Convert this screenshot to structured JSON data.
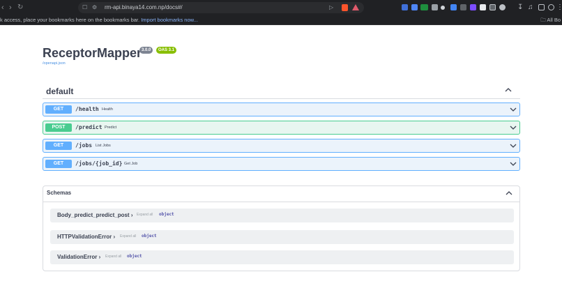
{
  "browser": {
    "url": "rm-api.binaya14.com.np/docs#/",
    "bookmarks_bar_text": "k access, place your bookmarks here on the bookmarks bar.",
    "import_link": "Import bookmarks now...",
    "all_bookmarks": "All Bo",
    "icons": [
      "back-icon",
      "forward-icon",
      "reload-icon",
      "bookmark-icon",
      "site-info-icon",
      "play-icon",
      "brave-shield-icon",
      "rewards-icon"
    ]
  },
  "api": {
    "title": "ReceptorMapper",
    "version": "3.0.0",
    "oas": "OAS 3.1",
    "spec_link": "/openapi.json"
  },
  "section": {
    "title": "default"
  },
  "operations": [
    {
      "method": "GET",
      "path": "/health",
      "summary": "Health"
    },
    {
      "method": "POST",
      "path": "/predict",
      "summary": "Predict"
    },
    {
      "method": "GET",
      "path": "/jobs",
      "summary": "List Jobs"
    },
    {
      "method": "GET",
      "path": "/jobs/{job_id}",
      "summary": "Get Job"
    }
  ],
  "schemas": {
    "title": "Schemas",
    "expand_label": "Expand all",
    "models": [
      {
        "name": "Body_predict_predict_post",
        "type": "object"
      },
      {
        "name": "HTTPValidationError",
        "type": "object"
      },
      {
        "name": "ValidationError",
        "type": "object"
      }
    ]
  },
  "colors": {
    "get": "#61affe",
    "post": "#49cc90",
    "oas_badge": "#89bf04"
  }
}
